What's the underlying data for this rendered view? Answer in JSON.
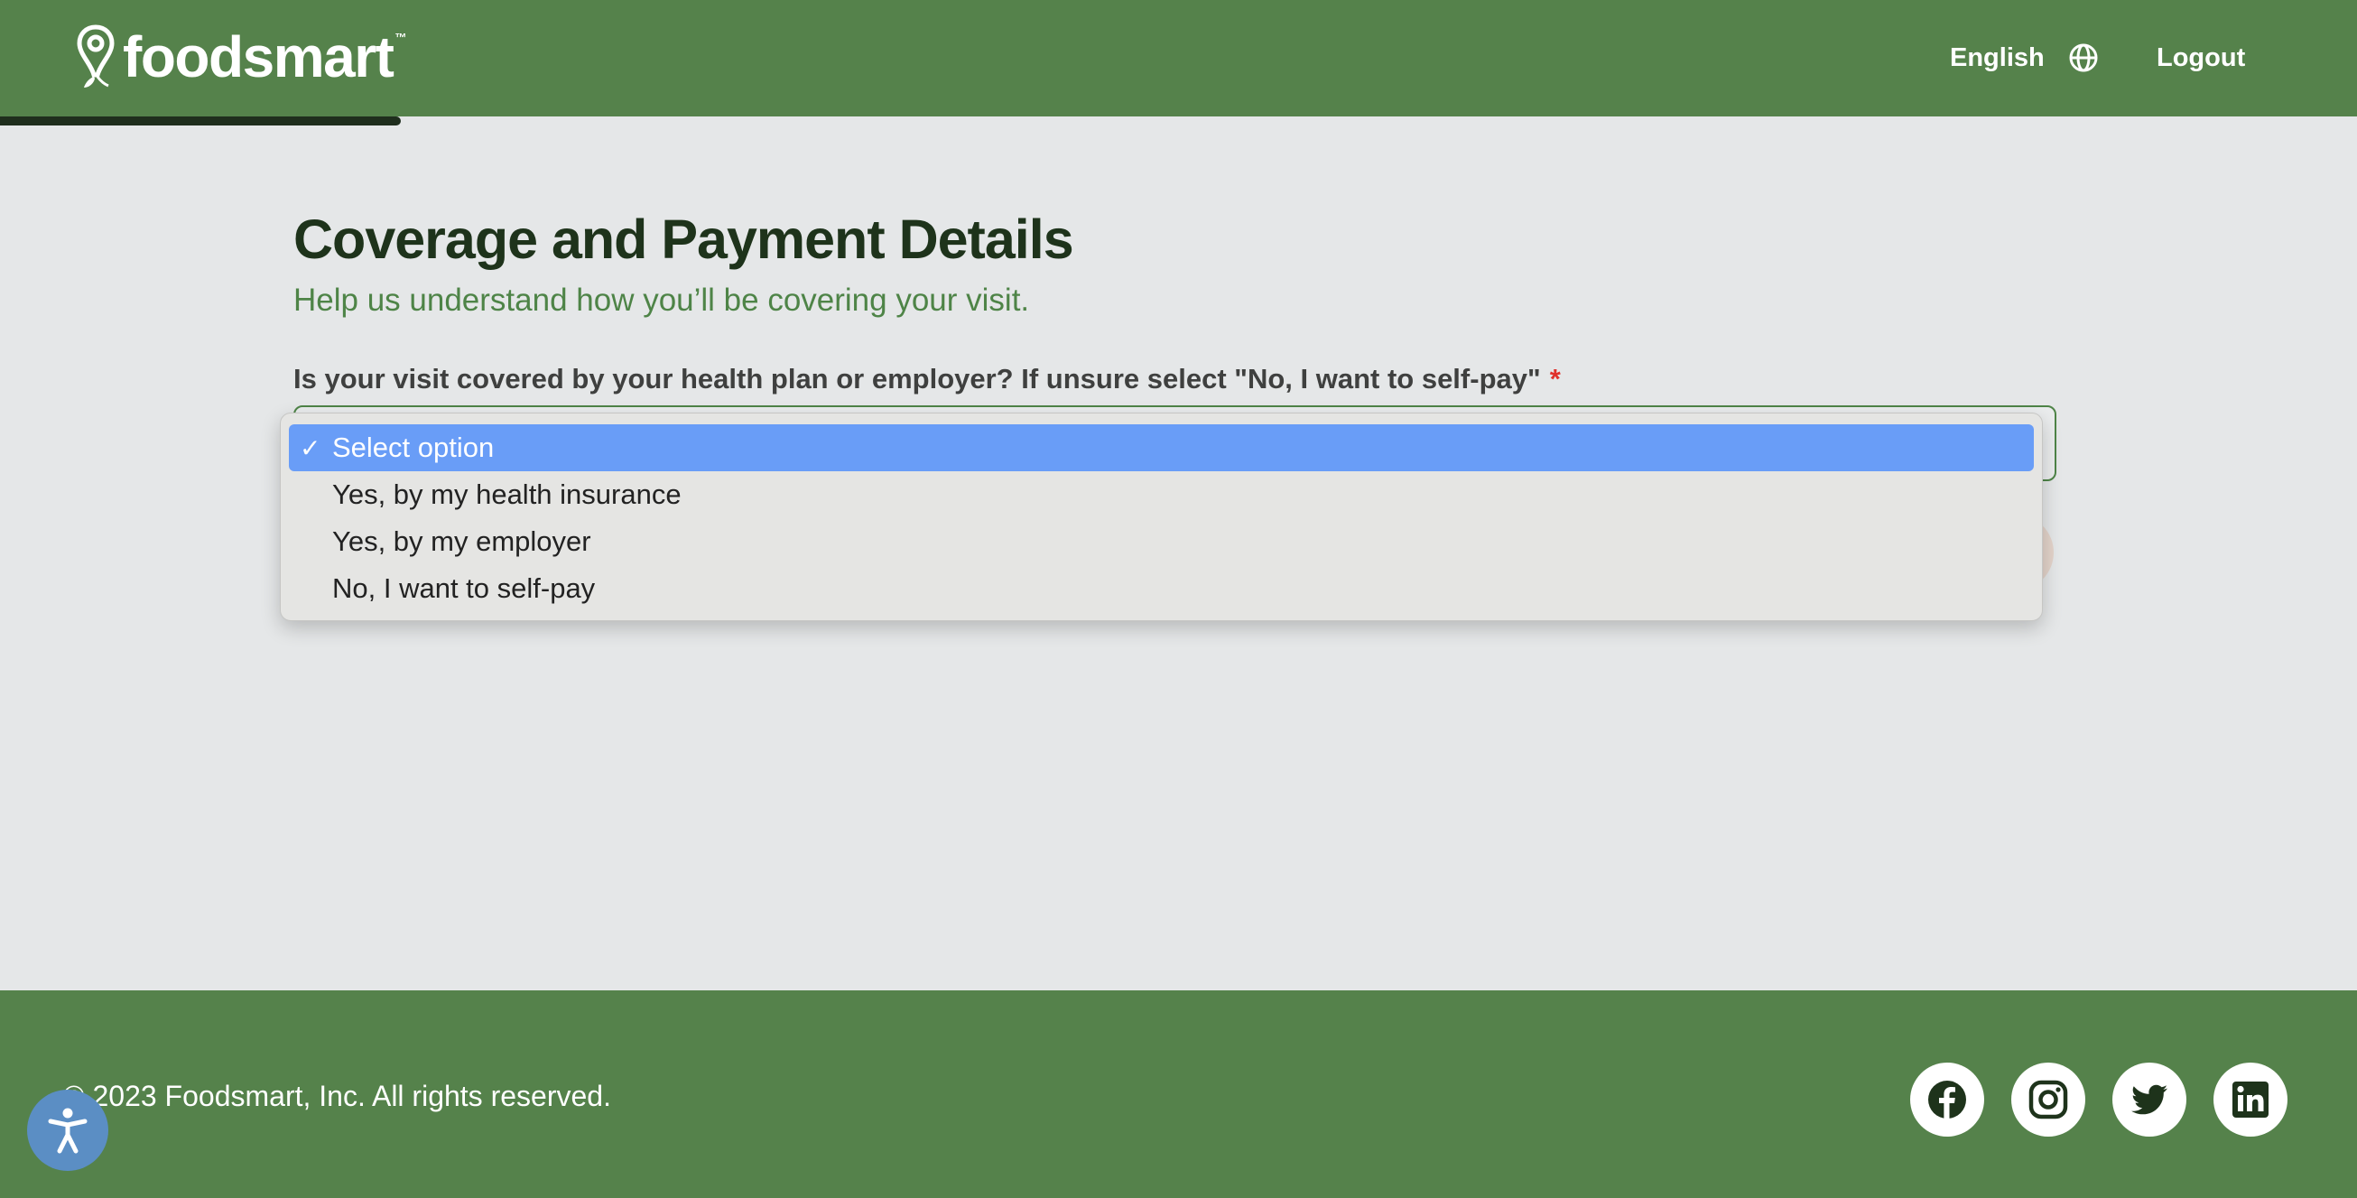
{
  "header": {
    "logo_text": "foodsmart",
    "logo_tm": "™",
    "language_label": "English",
    "logout_label": "Logout",
    "progress": 0.17
  },
  "main": {
    "title": "Coverage and Payment Details",
    "subtitle": "Help us understand how you’ll be covering your visit.",
    "question": "Is your visit covered by your health plan or employer? If unsure select \"No, I want to self-pay\"",
    "required_marker": "*",
    "dropdown": {
      "check_mark": "✓",
      "options": [
        "Select option",
        "Yes, by my health insurance",
        "Yes, by my employer",
        "No, I want to self-pay"
      ],
      "selected_index": 0
    }
  },
  "footer": {
    "copyright": "© 2023 Foodsmart, Inc. All rights reserved.",
    "social": [
      "facebook-icon",
      "instagram-icon",
      "twitter-icon",
      "linkedin-icon"
    ]
  },
  "colors": {
    "brand_green": "#55824b",
    "dark_green": "#1e331b",
    "subtitle_green": "#4e8447",
    "selected_blue": "#699df7",
    "required_red": "#e0312b"
  }
}
